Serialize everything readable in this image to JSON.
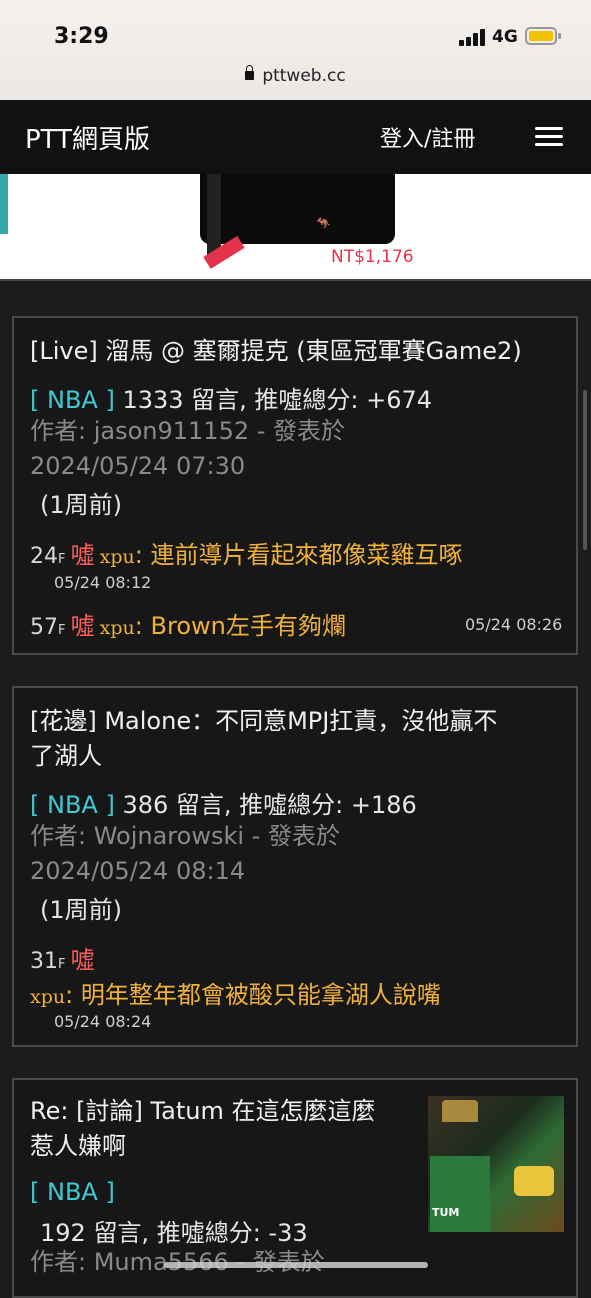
{
  "status_bar": {
    "time": "3:29",
    "network": "4G"
  },
  "browser": {
    "url": "pttweb.cc"
  },
  "header": {
    "brand": "PTT網頁版",
    "login": "登入/註冊"
  },
  "ad": {
    "price": "NT$1,176"
  },
  "posts": [
    {
      "title": "[Live] 溜馬 @ 塞爾提克 (東區冠軍賽Game2)",
      "board": "[ NBA ]",
      "stats": "1333 留言, 推噓總分: +674",
      "author_line": "作者: jason911152 - 發表於",
      "date": "2024/05/24 07:30",
      "ago": "(1周前)",
      "comments": [
        {
          "floor": "24",
          "floor_suffix": "F",
          "tag": "噓",
          "user": "xpu",
          "text": ": 連前導片看起來都像菜雞互啄",
          "time": "05/24 08:12"
        },
        {
          "floor": "57",
          "floor_suffix": "F",
          "tag": "噓",
          "user": "xpu",
          "text": ": Brown左手有夠爛",
          "time": "05/24 08:26"
        }
      ]
    },
    {
      "title_line1": "[花邊] Malone：不同意MPJ扛責，沒他贏不",
      "title_line2": "了湖人",
      "board": "[ NBA ]",
      "stats": "386 留言, 推噓總分: +186",
      "author_line": "作者: Wojnarowski - 發表於",
      "date": "2024/05/24 08:14",
      "ago": "(1周前)",
      "comments": [
        {
          "floor": "31",
          "floor_suffix": "F",
          "tag": "噓",
          "user": "xpu",
          "text": ": 明年整年都會被酸只能拿湖人說嘴",
          "time": "05/24 08:24"
        }
      ]
    },
    {
      "title_line1": "Re: [討論] Tatum 在這怎麼這麼",
      "title_line2": "惹人嫌啊",
      "board": "[ NBA ]",
      "stats": "192 留言, 推噓總分: -33",
      "author_line": "作者: Muma5566 - 發表於",
      "thumb_label": "TUM"
    }
  ]
}
